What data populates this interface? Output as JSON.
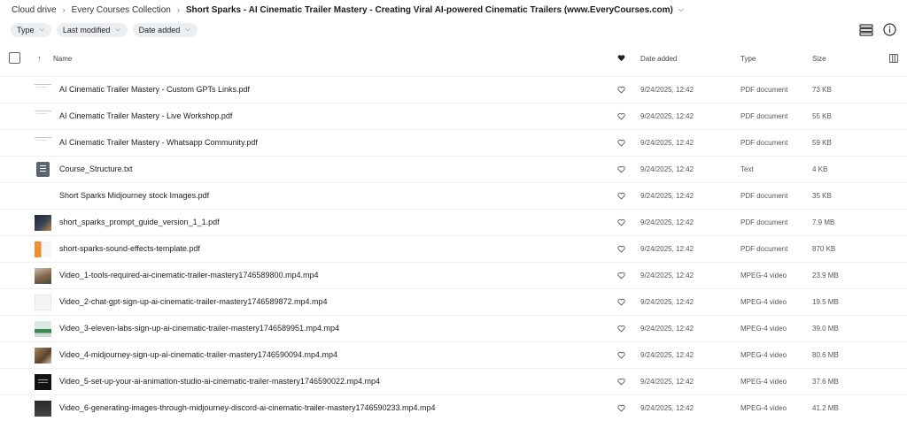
{
  "breadcrumb": {
    "root": "Cloud drive",
    "parent": "Every Courses Collection",
    "current": "Short Sparks - AI Cinematic Trailer Mastery - Creating Viral AI-powered Cinematic Trailers (www.EveryCourses.com)"
  },
  "filters": {
    "type": "Type",
    "modified": "Last modified",
    "date_added": "Date added"
  },
  "columns": {
    "name": "Name",
    "date_added": "Date added",
    "type": "Type",
    "size": "Size"
  },
  "icons": {
    "list_view": "list-view-icon",
    "info": "info-icon",
    "favourite": "heart-icon",
    "column_settings": "columns-icon"
  },
  "files": [
    {
      "name": "AI Cinematic Trailer Mastery - Custom GPTs Links.pdf",
      "date": "9/24/2025, 12:42",
      "type": "PDF document",
      "size": "73 KB"
    },
    {
      "name": "AI Cinematic Trailer Mastery - Live Workshop.pdf",
      "date": "9/24/2025, 12:42",
      "type": "PDF document",
      "size": "55 KB"
    },
    {
      "name": "AI Cinematic Trailer Mastery - Whatsapp Community.pdf",
      "date": "9/24/2025, 12:42",
      "type": "PDF document",
      "size": "59 KB"
    },
    {
      "name": "Course_Structure.txt",
      "date": "9/24/2025, 12:42",
      "type": "Text",
      "size": "4 KB"
    },
    {
      "name": "Short Sparks Midjourney stock Images.pdf",
      "date": "9/24/2025, 12:42",
      "type": "PDF document",
      "size": "35 KB"
    },
    {
      "name": "short_sparks_prompt_guide_version_1_1.pdf",
      "date": "9/24/2025, 12:42",
      "type": "PDF document",
      "size": "7.9 MB"
    },
    {
      "name": "short-sparks-sound-effects-template.pdf",
      "date": "9/24/2025, 12:42",
      "type": "PDF document",
      "size": "870 KB"
    },
    {
      "name": "Video_1-tools-required-ai-cinematic-trailer-mastery1746589800.mp4.mp4",
      "date": "9/24/2025, 12:42",
      "type": "MPEG-4 video",
      "size": "23.9 MB"
    },
    {
      "name": "Video_2-chat-gpt-sign-up-ai-cinematic-trailer-mastery1746589872.mp4.mp4",
      "date": "9/24/2025, 12:42",
      "type": "MPEG-4 video",
      "size": "19.5 MB"
    },
    {
      "name": "Video_3-eleven-labs-sign-up-ai-cinematic-trailer-mastery1746589951.mp4.mp4",
      "date": "9/24/2025, 12:42",
      "type": "MPEG-4 video",
      "size": "39.0 MB"
    },
    {
      "name": "Video_4-midjourney-sign-up-ai-cinematic-trailer-mastery1746590094.mp4.mp4",
      "date": "9/24/2025, 12:42",
      "type": "MPEG-4 video",
      "size": "80.6 MB"
    },
    {
      "name": "Video_5-set-up-your-ai-animation-studio-ai-cinematic-trailer-mastery1746590022.mp4.mp4",
      "date": "9/24/2025, 12:42",
      "type": "MPEG-4 video",
      "size": "37.6 MB"
    },
    {
      "name": "Video_6-generating-images-through-midjourney-discord-ai-cinematic-trailer-mastery1746590233.mp4.mp4",
      "date": "9/24/2025, 12:42",
      "type": "MPEG-4 video",
      "size": "41.2 MB"
    }
  ]
}
